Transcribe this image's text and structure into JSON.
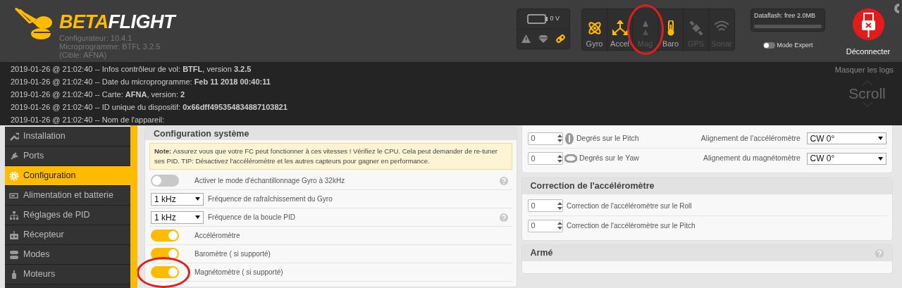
{
  "header": {
    "logo": {
      "text_1": "BETA",
      "text_2": "FLIGHT"
    },
    "configurator_version": "Configurateur: 10.4.1",
    "firmware": "Microprogramme: BTFL 3.2.5 (Cible: AFNA)",
    "battery": {
      "reading": "0 V"
    },
    "status_indicators": [
      {
        "kind": "warning",
        "on": false
      },
      {
        "kind": "failsafe",
        "on": false
      },
      {
        "kind": "link",
        "on": true
      }
    ],
    "sensors": [
      {
        "kind": "gyro",
        "label": "Gyro",
        "on": true,
        "circled": false
      },
      {
        "kind": "accel",
        "label": "Accel",
        "on": true,
        "circled": false
      },
      {
        "kind": "mag",
        "label": "Mag",
        "on": false,
        "circled": true
      },
      {
        "kind": "baro",
        "label": "Baro",
        "on": true,
        "circled": false
      },
      {
        "kind": "gps",
        "label": "GPS",
        "on": false,
        "circled": false
      },
      {
        "kind": "sonar",
        "label": "Sonar",
        "on": false,
        "circled": false
      }
    ],
    "dataflash": {
      "label": "Dataflash: free 2.0MB",
      "level": 0
    },
    "expert_mode": {
      "label": "Mode Expert",
      "on": false
    },
    "disconnect": {
      "label": "Déconnecter"
    }
  },
  "logs": {
    "lines": [
      "2019-01-26 @ 21:02:40 -- Infos contrôleur de vol: **BTFL**, version **3.2.5**",
      "2019-01-26 @ 21:02:40 -- Date du microprogramme: **Feb 11 2018 00:40:11**",
      "2019-01-26 @ 21:02:40 -- Carte: **AFNA**, version: **2**",
      "2019-01-26 @ 21:02:40 -- ID unique du dispositif: **0x66dff495354834887103821**",
      "2019-01-26 @ 21:02:40 -- Nom de l'appareil:"
    ],
    "hide_label": "Masquer les logs",
    "scroll_label": "Scroll"
  },
  "sidebar": {
    "items": [
      {
        "kind": "wrench",
        "label": "Installation",
        "selected": false
      },
      {
        "kind": "plug",
        "label": "Ports",
        "selected": false
      },
      {
        "kind": "gear",
        "label": "Configuration",
        "selected": true
      },
      {
        "kind": "battery",
        "label": "Alimentation et batterie",
        "selected": false
      },
      {
        "kind": "pid",
        "label": "Réglages de PID",
        "selected": false
      },
      {
        "kind": "receiver",
        "label": "Récepteur",
        "selected": false
      },
      {
        "kind": "modes",
        "label": "Modes",
        "selected": false
      },
      {
        "kind": "motor",
        "label": "Moteurs",
        "selected": false
      }
    ]
  },
  "system_config": {
    "title": "Configuration système",
    "note": "**Note:** Assurez vous que votre FC peut fonctionner à ces vitesses ! Vérifiez le CPU. Cela peut demander de re-tuner ses PID. TIP: Désactivez l'accéléromètre et les autres capteurs pour gagner en performance.",
    "rows": [
      {
        "kind": "toggle",
        "on": false,
        "label": "Activer le mode d'échantillonnage Gyro à 32kHz",
        "help": true,
        "circled": false
      },
      {
        "kind": "select",
        "value": "1 kHz",
        "label": "Fréquence de rafraîchissement du Gyro",
        "help": false,
        "circled": false
      },
      {
        "kind": "select",
        "value": "1 kHz",
        "label": "Fréquence de la boucle PID",
        "help": true,
        "circled": false
      },
      {
        "kind": "toggle",
        "on": true,
        "label": "Accéléromètre",
        "help": false,
        "circled": false
      },
      {
        "kind": "toggle",
        "on": true,
        "label": "Baromètre ( si supporté)",
        "help": false,
        "circled": false
      },
      {
        "kind": "toggle",
        "on": true,
        "label": "Magnétomètre ( si supporté)",
        "help": false,
        "circled": true
      }
    ]
  },
  "board_alignment": {
    "rows": [
      {
        "kind": "pitch",
        "value": "0",
        "label": "Degrés sur le Pitch",
        "align_label": "Alignement de l'accéléromètre",
        "align_value": "CW 0°"
      },
      {
        "kind": "yaw",
        "value": "0",
        "label": "Degrés sur le Yaw",
        "align_label": "Alignement du magnétomètre",
        "align_value": "CW 0°"
      }
    ]
  },
  "acc_correction": {
    "title": "Correction de l'accéléromètre",
    "rows": [
      {
        "value": "0",
        "label": "Correction de l'accéléromètre sur le Roll"
      },
      {
        "value": "0",
        "label": "Correction de l'accéléromètre sur le Pitch"
      }
    ]
  },
  "armed": {
    "title": "Armé",
    "help": true
  }
}
